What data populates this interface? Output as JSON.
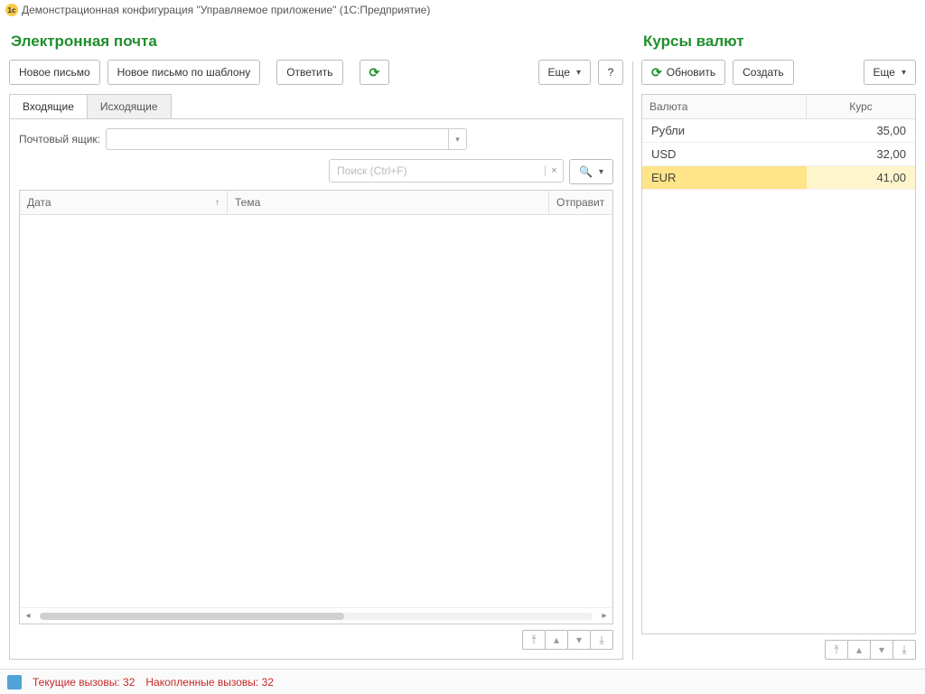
{
  "window": {
    "title": "Демонстрационная конфигурация \"Управляемое приложение\"  (1С:Предприятие)"
  },
  "email": {
    "title": "Электронная почта",
    "buttons": {
      "new": "Новое письмо",
      "new_template": "Новое письмо по шаблону",
      "reply": "Ответить",
      "more": "Еще",
      "help": "?"
    },
    "tabs": {
      "inbox": "Входящие",
      "outbox": "Исходящие"
    },
    "mailbox_label": "Почтовый ящик:",
    "mailbox_value": "",
    "search_placeholder": "Поиск (Ctrl+F)",
    "columns": {
      "date": "Дата",
      "subject": "Тема",
      "sender": "Отправит"
    }
  },
  "rates": {
    "title": "Курсы валют",
    "buttons": {
      "refresh": "Обновить",
      "create": "Создать",
      "more": "Еще"
    },
    "columns": {
      "currency": "Валюта",
      "rate": "Курс"
    },
    "rows": [
      {
        "currency": "Рубли",
        "rate": "35,00",
        "selected": false
      },
      {
        "currency": "USD",
        "rate": "32,00",
        "selected": false
      },
      {
        "currency": "EUR",
        "rate": "41,00",
        "selected": true
      }
    ]
  },
  "status": {
    "current_label": "Текущие вызовы:",
    "current_value": "32",
    "accumulated_label": "Накопленные вызовы:",
    "accumulated_value": "32"
  }
}
